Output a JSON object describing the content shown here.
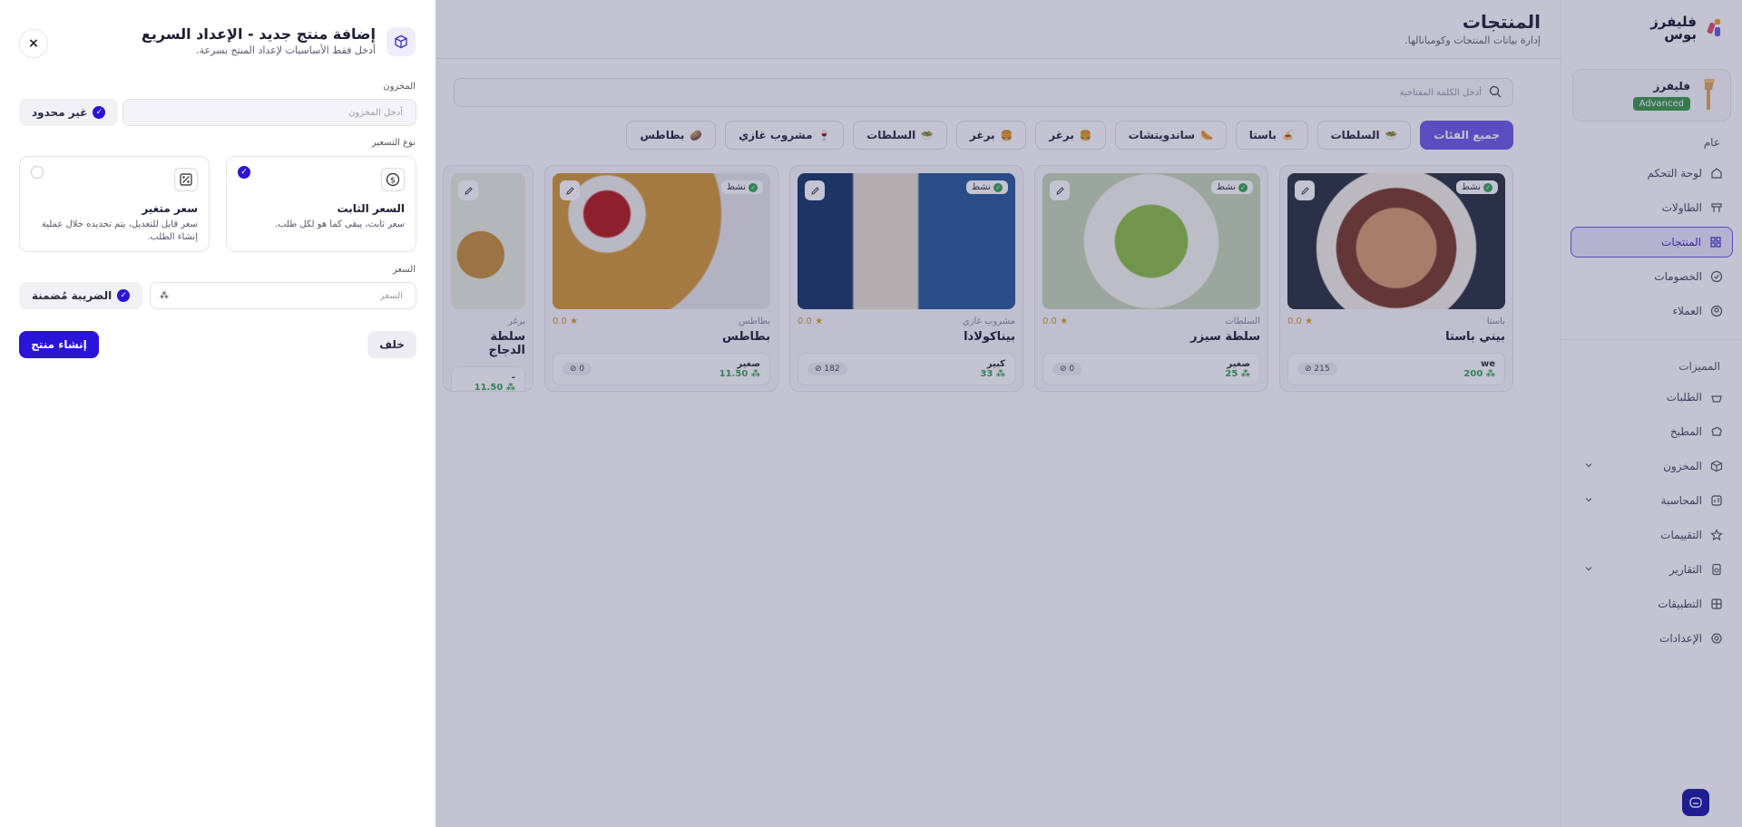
{
  "brand": {
    "name_line1": "فليفرز",
    "name_line2": "بوس"
  },
  "profile": {
    "name": "فليفرز",
    "badge": "Advanced"
  },
  "sidebar": {
    "section_general": "عام",
    "items_general": [
      {
        "label": "لوحة التحكم",
        "icon": "dashboard-icon"
      },
      {
        "label": "الطاولات",
        "icon": "table-icon"
      },
      {
        "label": "المنتجات",
        "icon": "grid-icon",
        "active": true
      },
      {
        "label": "الخصومات",
        "icon": "discount-icon"
      },
      {
        "label": "العملاء",
        "icon": "user-icon"
      }
    ],
    "section_features": "المميزات",
    "items_features": [
      {
        "label": "الطلبات",
        "icon": "basket-icon"
      },
      {
        "label": "المطبخ",
        "icon": "chef-icon"
      },
      {
        "label": "المخزون",
        "icon": "box-icon",
        "expandable": true
      },
      {
        "label": "المحاسبة",
        "icon": "chart-icon",
        "expandable": true
      },
      {
        "label": "التقييمات",
        "icon": "star-icon"
      },
      {
        "label": "التقارير",
        "icon": "report-icon",
        "expandable": true
      },
      {
        "label": "التطبيقات",
        "icon": "apps-icon"
      },
      {
        "label": "الإعدادات",
        "icon": "gear-icon"
      }
    ]
  },
  "main": {
    "title": "المنتجات",
    "subtitle": "إدارة بيانات المنتجات وكومبانالها.",
    "search_placeholder": "أدخل الكلمة المفتاحية",
    "chips": [
      "جميع الفئات",
      "السلطات",
      "باستا",
      "ساندويتشات",
      "برغر",
      "برغر",
      "السلطات",
      "مشروب غازي",
      "بطاطس"
    ],
    "cards": [
      {
        "status": "نشط",
        "category": "باستا",
        "rating": "0.0",
        "name": "بيني باستا",
        "size": "we",
        "price": "200",
        "stock": "215"
      },
      {
        "status": "نشط",
        "category": "السلطات",
        "rating": "0.0",
        "name": "سلطة سيزر",
        "size": "صغير",
        "price": "25",
        "stock": "0"
      },
      {
        "status": "نشط",
        "category": "مشروب غازي",
        "rating": "0.0",
        "name": "بيناكولادا",
        "size": "كبير",
        "price": "33",
        "stock": "182"
      },
      {
        "status": "نشط",
        "category": "بطاطس",
        "rating": "0.0",
        "name": "بطاطس",
        "size": "صغير",
        "price": "11.50",
        "stock": "0"
      },
      {
        "status": "",
        "category": "برغر",
        "rating": "",
        "name": "سلطة الدجاج",
        "size": "-",
        "price": "11.50",
        "stock": ""
      }
    ]
  },
  "drawer": {
    "title": "إضافة منتج جديد - الإعداد السريع",
    "subtitle": "أدخل فقط الأساسيات لإعداد المنتج بسرعة.",
    "close": "×",
    "stock_label": "المخزون",
    "stock_placeholder": "أدخل المخزون",
    "unlimited": "غير محدود",
    "pricing_label": "نوع التسعير",
    "fixed_title": "السعر الثابت",
    "fixed_desc": "سعر ثابت، يبقى كما هو لكل طلب.",
    "variable_title": "سعر متغير",
    "variable_desc": "سعر قابل للتعديل، يتم تحديده خلال عملية إنشاء الطلب.",
    "price_label": "السعر",
    "price_placeholder": "السعر",
    "tax_included": "الضريبة مُضمنة",
    "back": "خلف",
    "create": "إنشاء منتج"
  },
  "colors": {
    "accent": "#6c5ce7",
    "primary": "#2a14d8",
    "success": "#3aa655"
  }
}
